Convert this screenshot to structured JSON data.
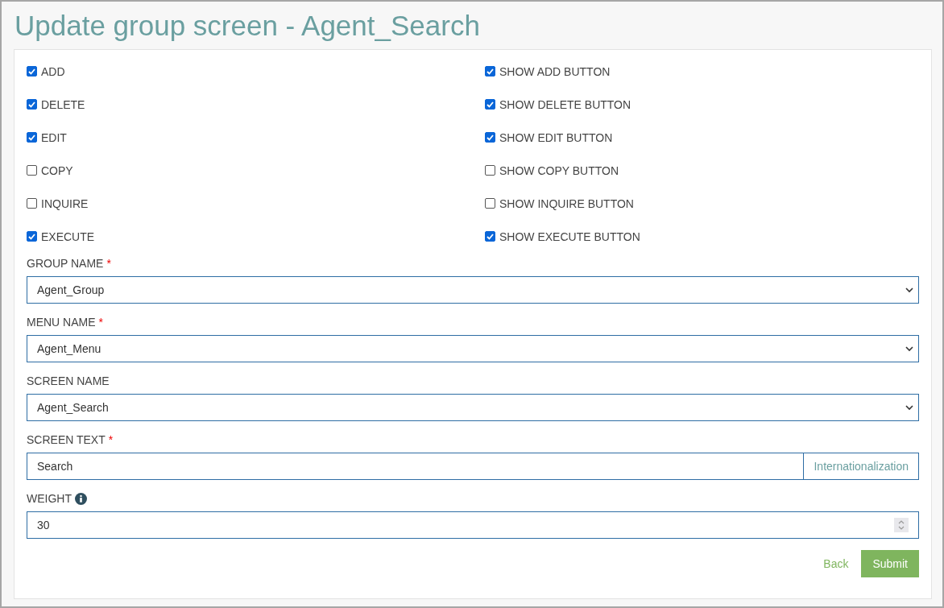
{
  "title": "Update group screen - Agent_Search",
  "permissions": [
    {
      "label": "ADD",
      "checked": true
    },
    {
      "label": "SHOW ADD BUTTON",
      "checked": true
    },
    {
      "label": "DELETE",
      "checked": true
    },
    {
      "label": "SHOW DELETE BUTTON",
      "checked": true
    },
    {
      "label": "EDIT",
      "checked": true
    },
    {
      "label": "SHOW EDIT BUTTON",
      "checked": true
    },
    {
      "label": "COPY",
      "checked": false
    },
    {
      "label": "SHOW COPY BUTTON",
      "checked": false
    },
    {
      "label": "INQUIRE",
      "checked": false
    },
    {
      "label": "SHOW INQUIRE BUTTON",
      "checked": false
    },
    {
      "label": "EXECUTE",
      "checked": true
    },
    {
      "label": "SHOW EXECUTE BUTTON",
      "checked": true
    }
  ],
  "fields": [
    {
      "kind": "select",
      "label": "GROUP NAME",
      "required_mark": "*",
      "value": "Agent_Group"
    },
    {
      "kind": "select",
      "label": "MENU NAME",
      "required_mark": "*",
      "value": "Agent_Menu"
    },
    {
      "kind": "select",
      "label": "SCREEN NAME",
      "value": "Agent_Search"
    },
    {
      "kind": "addon",
      "label": "SCREEN TEXT",
      "required_mark": "*",
      "value": "Search",
      "addon": "Internationalization"
    },
    {
      "kind": "number",
      "label": "WEIGHT",
      "info": true,
      "value": "30"
    }
  ],
  "buttons": {
    "back": "Back",
    "submit": "Submit"
  }
}
